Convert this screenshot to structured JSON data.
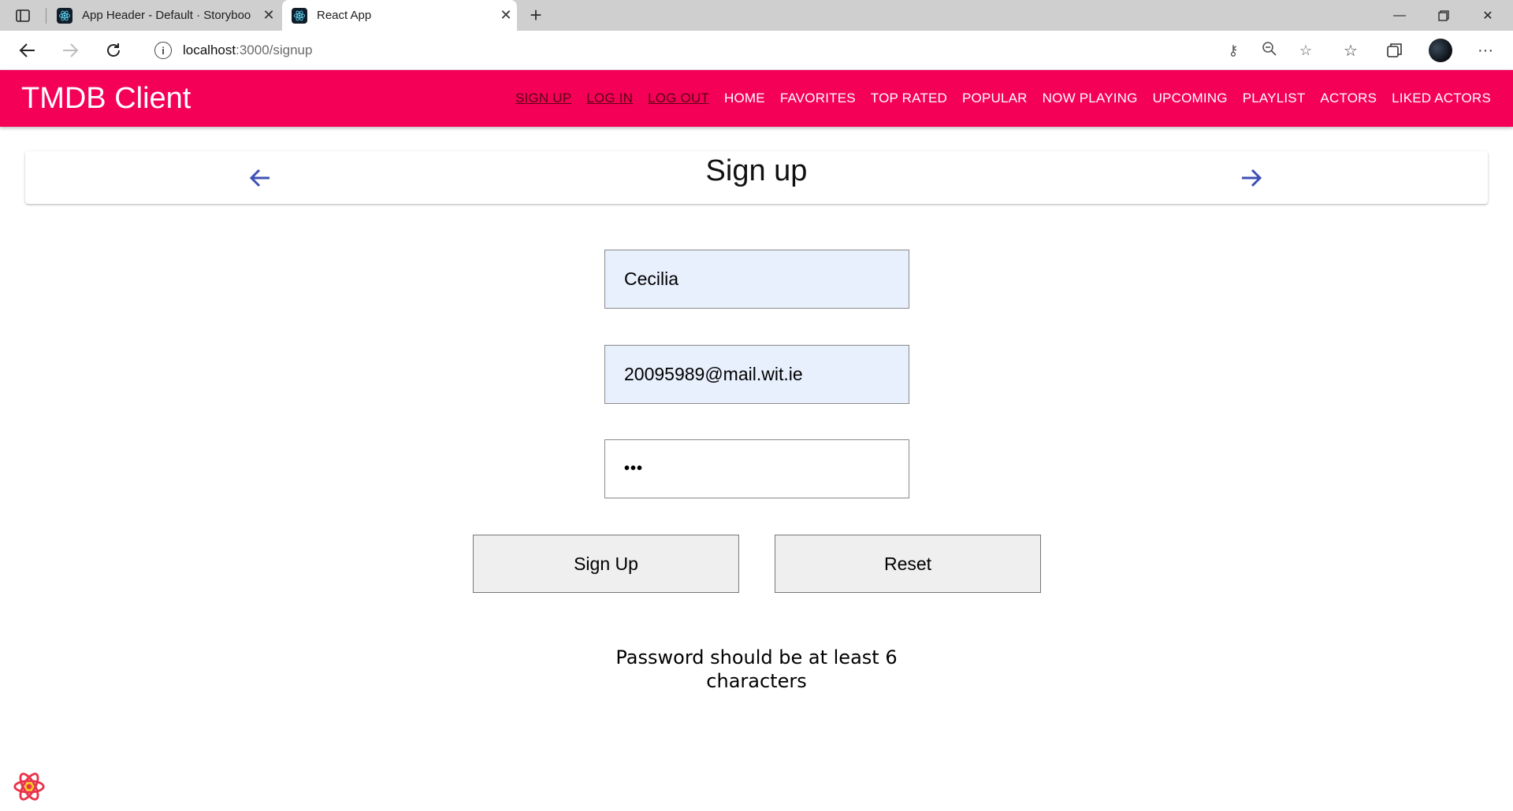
{
  "browser": {
    "tabs": [
      {
        "title": "App Header - Default · Storyboo",
        "active": false
      },
      {
        "title": "React App",
        "active": true
      }
    ],
    "url": {
      "host": "localhost",
      "path": ":3000/signup"
    }
  },
  "app": {
    "title": "TMDB Client",
    "nav": [
      {
        "label": "SIGN UP",
        "auth": true
      },
      {
        "label": "LOG IN",
        "auth": true
      },
      {
        "label": "LOG OUT",
        "auth": true
      },
      {
        "label": "HOME",
        "auth": false
      },
      {
        "label": "FAVORITES",
        "auth": false
      },
      {
        "label": "TOP RATED",
        "auth": false
      },
      {
        "label": "POPULAR",
        "auth": false
      },
      {
        "label": "NOW PLAYING",
        "auth": false
      },
      {
        "label": "UPCOMING",
        "auth": false
      },
      {
        "label": "PLAYLIST",
        "auth": false
      },
      {
        "label": "ACTORS",
        "auth": false
      },
      {
        "label": "LIKED ACTORS",
        "auth": false
      }
    ],
    "colors": {
      "appbar": "#f50057",
      "arrow": "#3f51b5"
    }
  },
  "page": {
    "title": "Sign up"
  },
  "form": {
    "name_value": "Cecilia",
    "email_value": "20095989@mail.wit.ie",
    "password_masked": "•••",
    "signup_label": "Sign Up",
    "reset_label": "Reset",
    "error_line1": "Password should be at least 6",
    "error_line2": "characters"
  }
}
